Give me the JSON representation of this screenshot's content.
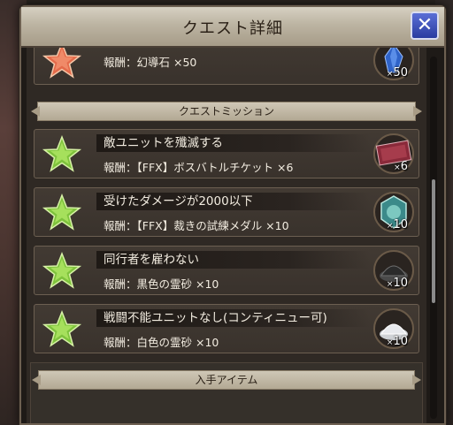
{
  "dialog": {
    "title": "クエスト詳細",
    "close_label": "✕"
  },
  "top_reward": {
    "reward_text": "報酬：幻導石 ×50",
    "item_qty": "50",
    "item_icon": "crystal-icon"
  },
  "mission_section": {
    "header": "クエストミッション",
    "missions": [
      {
        "title": "敵ユニットを殲滅する",
        "reward": "報酬：【FFX】ボスバトルチケット ×6",
        "qty": "6",
        "icon": "boss-ticket-icon"
      },
      {
        "title": "受けたダメージが2000以下",
        "reward": "報酬：【FFX】裁きの試練メダル ×10",
        "qty": "10",
        "icon": "trial-medal-icon"
      },
      {
        "title": "同行者を雇わない",
        "reward": "報酬：黒色の霊砂 ×10",
        "qty": "10",
        "icon": "black-sand-icon"
      },
      {
        "title": "戦闘不能ユニットなし(コンティニュー可)",
        "reward": "報酬：白色の霊砂 ×10",
        "qty": "10",
        "icon": "white-sand-icon"
      }
    ]
  },
  "items_section": {
    "header": "入手アイテム"
  },
  "colors": {
    "completed_star": "#8fd04a",
    "incomplete_star": "#e36a4a",
    "close_button": "#3b4fc0"
  }
}
